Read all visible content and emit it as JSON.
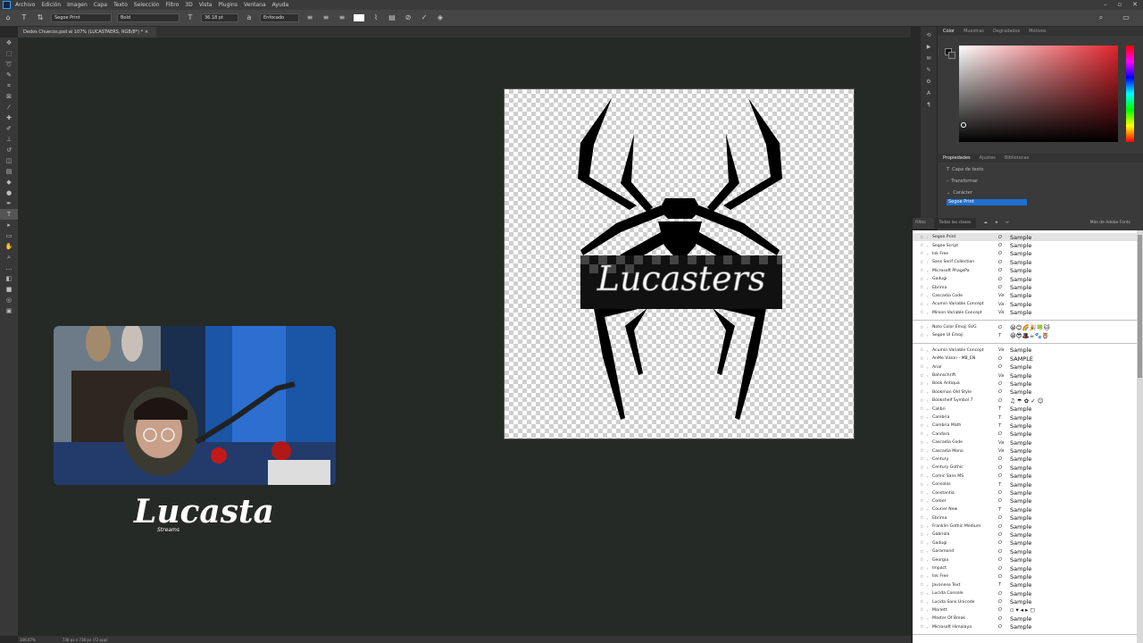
{
  "menu": [
    "Archivo",
    "Edición",
    "Imagen",
    "Capa",
    "Texto",
    "Selección",
    "Filtro",
    "3D",
    "Vista",
    "Plugins",
    "Ventana",
    "Ayuda"
  ],
  "options": {
    "font_family": "Segoe Print",
    "font_style": "Bold",
    "font_size": "36.18 pt",
    "antialias": "Enfocado"
  },
  "document": {
    "tab_title": "Dedos Chuecos.psd al 107% (LUCASTAERS, RGB/8*) *",
    "canvas_text": "Lucasters"
  },
  "status": {
    "zoom": "106.67%",
    "doc_info": "736 px x 736 px (72 ppp)"
  },
  "overlay": {
    "logo": "Lucasta",
    "logo_sub": "Streams"
  },
  "color_panel": {
    "tabs": [
      "Color",
      "Muestras",
      "Degradados",
      "Motivos"
    ]
  },
  "props_panel": {
    "tabs": [
      "Propiedades",
      "Ajustes",
      "Bibliotecas"
    ],
    "layer_type": "Capa de texto",
    "transform": "Transformar",
    "character": "Carácter",
    "font_input": "Segoe Print"
  },
  "font_filter": {
    "filter_label": "Filtro:",
    "filter_value": "Todas las clases",
    "more_fonts": "Más de Adobe Fonts"
  },
  "font_sections": [
    [
      {
        "name": "Segoe Print",
        "type": "O",
        "sample": "Sample"
      },
      {
        "name": "Segoe Script",
        "type": "O",
        "sample": "Sample"
      },
      {
        "name": "Ink Free",
        "type": "O",
        "sample": "Sample"
      },
      {
        "name": "Sans Serif Collection",
        "type": "O",
        "sample": "Sample"
      },
      {
        "name": "Microsoft PhagsPa",
        "type": "O",
        "sample": "Sample"
      },
      {
        "name": "Gadugi",
        "type": "O",
        "sample": "Sample"
      },
      {
        "name": "Ebrima",
        "type": "O",
        "sample": "Sample"
      },
      {
        "name": "Cascadia Code",
        "type": "Va",
        "sample": "Sample"
      },
      {
        "name": "Acumin Variable Concept",
        "type": "Va",
        "sample": "Sample"
      },
      {
        "name": "Minion Variable Concept",
        "type": "Va",
        "sample": "Sample"
      }
    ],
    [
      {
        "name": "Noto Color Emoji SVG",
        "type": "O",
        "sample": "😀😊🌈🎉🍀🐱"
      },
      {
        "name": "Segoe UI Emoji",
        "type": "T",
        "sample": "😀😎🎩☕🐾🦉"
      }
    ],
    [
      {
        "name": "Acumin Variable Concept",
        "type": "Va",
        "sample": "Sample"
      },
      {
        "name": "AnMe Vision - MB_EN",
        "type": "O",
        "sample": "SAMPLE"
      },
      {
        "name": "Arial",
        "type": "O",
        "sample": "Sample"
      },
      {
        "name": "Bahnschrift",
        "type": "Va",
        "sample": "Sample"
      },
      {
        "name": "Book Antiqua",
        "type": "O",
        "sample": "Sample"
      },
      {
        "name": "Bookman Old Style",
        "type": "O",
        "sample": "Sample"
      },
      {
        "name": "Bookshelf Symbol 7",
        "type": "O",
        "sample": "♫ ☂ ✿ ✓ ☺"
      },
      {
        "name": "Calibri",
        "type": "T",
        "sample": "Sample"
      },
      {
        "name": "Cambria",
        "type": "T",
        "sample": "Sample"
      },
      {
        "name": "Cambria Math",
        "type": "T",
        "sample": "Sample"
      },
      {
        "name": "Candara",
        "type": "O",
        "sample": "Sample"
      },
      {
        "name": "Cascadia Code",
        "type": "Va",
        "sample": "Sample"
      },
      {
        "name": "Cascadia Mono",
        "type": "Va",
        "sample": "Sample"
      },
      {
        "name": "Century",
        "type": "O",
        "sample": "Sample"
      },
      {
        "name": "Century Gothic",
        "type": "O",
        "sample": "Sample"
      },
      {
        "name": "Comic Sans MS",
        "type": "O",
        "sample": "Sample"
      },
      {
        "name": "Consolas",
        "type": "T",
        "sample": "Sample"
      },
      {
        "name": "Constantia",
        "type": "O",
        "sample": "Sample"
      },
      {
        "name": "Corbel",
        "type": "O",
        "sample": "Sample"
      },
      {
        "name": "Courier New",
        "type": "T",
        "sample": "Sample"
      },
      {
        "name": "Ebrima",
        "type": "O",
        "sample": "Sample"
      },
      {
        "name": "Franklin Gothic Medium",
        "type": "O",
        "sample": "Sample"
      },
      {
        "name": "Gabriola",
        "type": "O",
        "sample": "Sample"
      },
      {
        "name": "Gadugi",
        "type": "O",
        "sample": "Sample"
      },
      {
        "name": "Garamond",
        "type": "O",
        "sample": "Sample"
      },
      {
        "name": "Georgia",
        "type": "O",
        "sample": "Sample"
      },
      {
        "name": "Impact",
        "type": "O",
        "sample": "Sample"
      },
      {
        "name": "Ink Free",
        "type": "O",
        "sample": "Sample"
      },
      {
        "name": "Javanese Text",
        "type": "T",
        "sample": "Sample"
      },
      {
        "name": "Lucida Console",
        "type": "O",
        "sample": "Sample"
      },
      {
        "name": "Lucida Sans Unicode",
        "type": "O",
        "sample": "Sample"
      },
      {
        "name": "Marlett",
        "type": "O",
        "sample": "▫ ▾ ◂ ▸ ◻"
      },
      {
        "name": "Master Of Break",
        "type": "O",
        "sample": "Sample"
      },
      {
        "name": "Microsoft Himalaya",
        "type": "O",
        "sample": "Sample"
      }
    ]
  ]
}
